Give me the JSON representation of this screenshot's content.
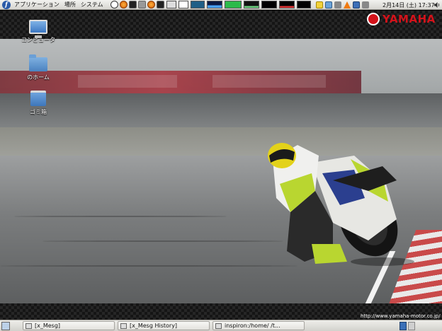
{
  "top_panel": {
    "menus": [
      "アプリケーション",
      "場所",
      "システム"
    ],
    "clock": "2月14日 (土) 17:37"
  },
  "desktop": {
    "icons": [
      {
        "label": "コンピュータ",
        "icon": "computer-icon"
      },
      {
        "label": "のホーム",
        "icon": "home-folder-icon"
      },
      {
        "label": "ゴミ箱",
        "icon": "trash-icon"
      }
    ],
    "wallpaper": {
      "logo_text": "YAMAHA",
      "url": "http://www.yamaha-motor.co.jp/"
    }
  },
  "taskbar": {
    "tasks": [
      "[x_Mesg]",
      "[x_Mesg  History]",
      "inspiron:/home/          /t..."
    ]
  },
  "colors": {
    "yamaha_red": "#d3121a",
    "panel": "#e2e1dc"
  }
}
